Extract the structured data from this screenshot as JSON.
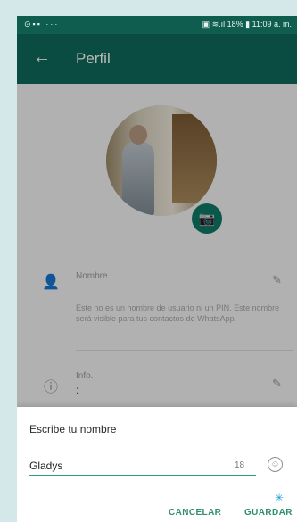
{
  "status_bar": {
    "left_icons": "⊙▪▪ ···",
    "right_text": "▣ ≋.ıl 18% ▮ 11:09 a. m."
  },
  "app_bar": {
    "back_icon": "←",
    "title": "Perfil"
  },
  "profile": {
    "camera_icon": "📷",
    "name_row": {
      "icon": "👤",
      "label": "Nombre",
      "edit_icon": "✎"
    },
    "hint": "Este no es un nombre de usuario ni un PIN. Este nombre será visible para tus contactos de WhatsApp.",
    "info_row": {
      "icon": "ⓘ",
      "label": "Info.",
      "value": ":",
      "edit_icon": "✎"
    }
  },
  "dialog": {
    "title": "Escribe tu nombre",
    "input_value": "Gladys",
    "char_counter": "18",
    "emoji_icon": "☺",
    "cancel_label": "CANCELAR",
    "save_label": "GUARDAR",
    "accent_color": "#2f8d72"
  },
  "colors": {
    "header": "#0f6a5a",
    "statusbar": "#0e5d4f",
    "fab": "#0f7a67"
  }
}
